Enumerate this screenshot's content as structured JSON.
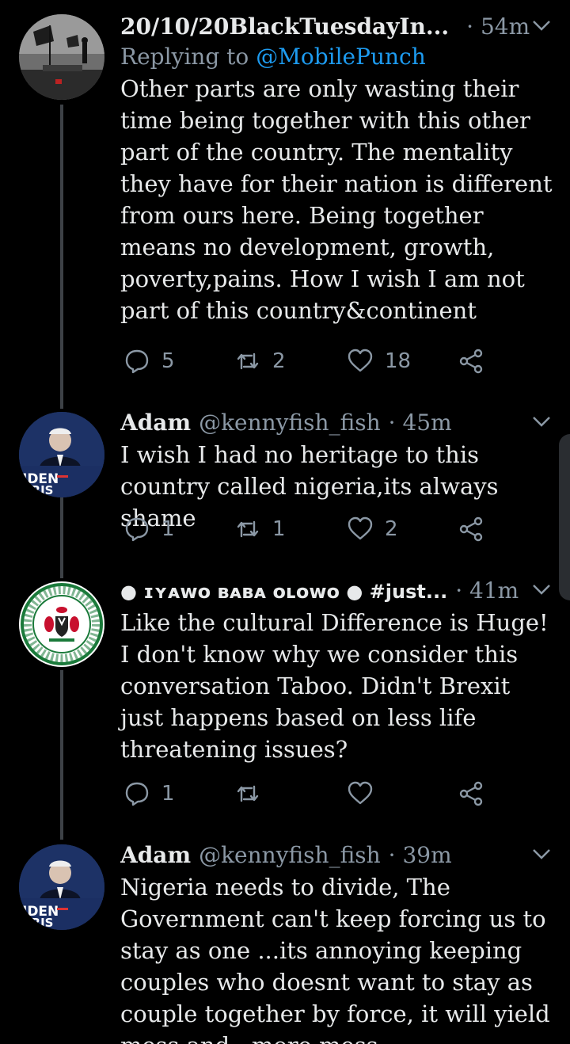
{
  "colors": {
    "background": "#000000",
    "text": "#e7e9ea",
    "muted": "#8b98a5",
    "accent": "#1d9bf0",
    "thread_line": "#3d4146"
  },
  "tweets": [
    {
      "name": "20/10/20BlackTuesdayIn...",
      "handle": "",
      "time": "· 54m",
      "replying_prefix": "Replying to",
      "replying_to": "@MobilePunch",
      "text": "Other parts are only wasting their time being together with this other part of the country. The mentality they have for their nation is different from ours here. Being together means no development, growth, poverty,pains. How I wish I am not part of this country&continent",
      "replies": "5",
      "retweets": "2",
      "likes": "18",
      "avatar_icon": "protest-photo-avatar"
    },
    {
      "name": "Adam",
      "handle": "@kennyfish_fish",
      "time": "· 45m",
      "text": "I wish I had no heritage to this country called nigeria,its always shame",
      "replies": "1",
      "retweets": "1",
      "likes": "2",
      "avatar_text_1": "IDEN",
      "avatar_text_2": "RRIS"
    },
    {
      "name": "● ɪʏᴀᴡᴏ ʙᴀʙᴀ ᴏʟᴏᴡᴏ ● #just...",
      "handle": "",
      "time": "· 41m",
      "text": "Like the cultural Difference is Huge! I don't know why we consider this conversation Taboo. Didn't Brexit just happens based on less life threatening issues?",
      "replies": "1",
      "retweets": "",
      "likes": "",
      "avatar_icon": "nigeria-seal-avatar"
    },
    {
      "name": "Adam",
      "handle": "@kennyfish_fish",
      "time": "· 39m",
      "text": "Nigeria needs to divide, The Government can't keep forcing us to stay as one ...its annoying keeping couples who doesnt want to stay as couple together by force, it will yield mess and...more mess",
      "avatar_text_1": "IDEN",
      "avatar_text_2": "RRIS"
    }
  ]
}
